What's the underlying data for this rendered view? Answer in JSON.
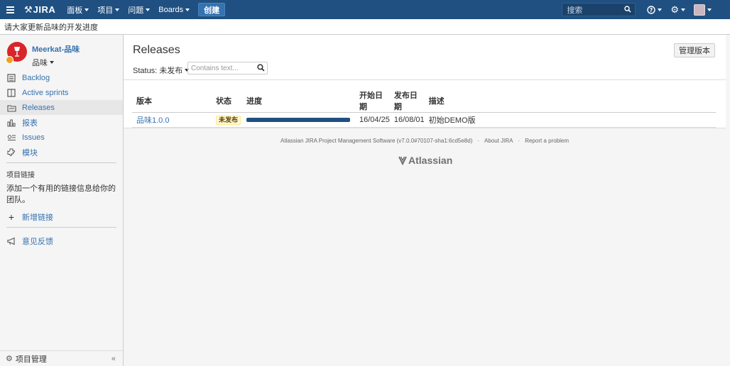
{
  "topnav": {
    "logo": "JIRA",
    "items": [
      "面板",
      "项目",
      "问题",
      "Boards"
    ],
    "create_label": "创建",
    "search_placeholder": "搜索"
  },
  "announcement": "请大家更新品味的开发进度",
  "sidebar": {
    "project_name": "Meerkat-品味",
    "project_type": "品味",
    "nav": [
      {
        "label": "Backlog",
        "icon": "backlog-icon"
      },
      {
        "label": "Active sprints",
        "icon": "board-icon"
      },
      {
        "label": "Releases",
        "icon": "releases-icon",
        "active": true
      },
      {
        "label": "报表",
        "icon": "reports-icon"
      },
      {
        "label": "Issues",
        "icon": "issues-icon"
      },
      {
        "label": "模块",
        "icon": "components-icon"
      }
    ],
    "links_title": "项目链接",
    "links_desc": "添加一个有用的链接信息给你的团队。",
    "add_link": "新增链接",
    "feedback": "意见反馈",
    "footer_label": "项目管理",
    "collapse": "«"
  },
  "main": {
    "title": "Releases",
    "manage_button": "管理版本",
    "status_filter": "Status: 未发布",
    "search_placeholder": "Contains text...",
    "columns": [
      "版本",
      "状态",
      "进度",
      "开始日期",
      "发布日期",
      "描述"
    ],
    "rows": [
      {
        "version": "品味1.0.0",
        "status": "未发布",
        "progress": 1.0,
        "start": "16/04/25",
        "release": "16/08/01",
        "desc": "初始DEMO版"
      }
    ]
  },
  "footer": {
    "software": "Atlassian JIRA Project Management Software (v7.0.0#70107-sha1:6cd5e8d)",
    "about": "About JIRA",
    "report": "Report a problem",
    "brand": "Atlassian"
  },
  "colors": {
    "header": "#205081",
    "link": "#3572b0",
    "progress": "#205081"
  }
}
